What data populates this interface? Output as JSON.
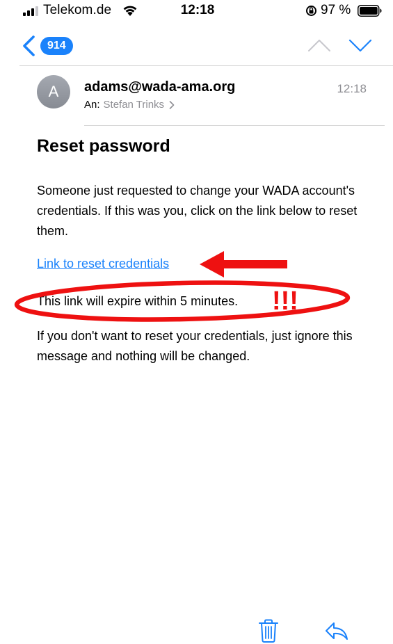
{
  "status_bar": {
    "carrier": "Telekom.de",
    "time": "12:18",
    "battery_percent": "97 %",
    "battery_level": 0.97,
    "icons": [
      "signal-icon",
      "wifi-icon",
      "orientation-lock-icon",
      "battery-icon"
    ]
  },
  "nav": {
    "unread_count": "914",
    "icons": [
      "back-chevron-icon",
      "chevron-up-icon",
      "chevron-down-icon"
    ]
  },
  "message": {
    "avatar_initial": "A",
    "sender": "adams@wada-ama.org",
    "time": "12:18",
    "recipient_prefix": "An:",
    "recipient_name": "Stefan Trinks",
    "subject": "Reset password",
    "body_p1": "Someone just requested to change your WADA account's credentials. If this was you, click on the link below to reset them.",
    "link_text": "Link to reset credentials",
    "expiry_text": "This link will expire within 5 minutes.",
    "body_p3": "If you don't want to reset your credentials, just ignore this message and nothing will be changed."
  },
  "annotation": {
    "exclamation": "!!!",
    "color": "#ee1111"
  },
  "toolbar": {
    "icons": [
      "trash-icon",
      "reply-icon"
    ]
  },
  "colors": {
    "accent": "#1a82fb",
    "secondary_text": "#8e8e93",
    "divider": "#d6d6d6"
  }
}
